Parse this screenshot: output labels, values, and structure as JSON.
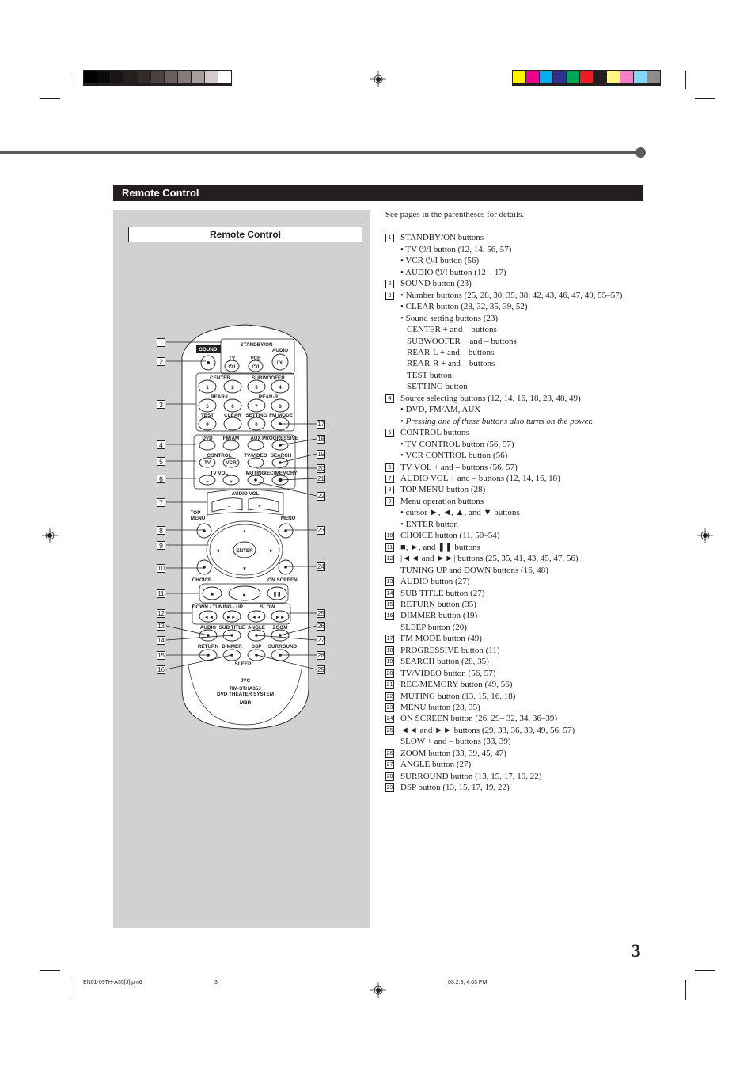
{
  "print_marks": {
    "gray_swatches": [
      "#000000",
      "#0c0a09",
      "#181514",
      "#25201e",
      "#342c2b",
      "#4a4241",
      "#6b605f",
      "#857b7a",
      "#a59d9c",
      "#d3cbca",
      "#ffffff"
    ],
    "color_swatches": [
      "#fff200",
      "#ec008c",
      "#00aeef",
      "#2e3192",
      "#00a651",
      "#ed1c24",
      "#231f20",
      "#fff67f",
      "#f680c6",
      "#80d8f7",
      "#8c8c8c"
    ]
  },
  "section_title": "Remote Control",
  "panel_title": "Remote Control",
  "remote": {
    "sound_label": "SOUND",
    "standby_label": "STANDBY/ON",
    "tv_label": "TV",
    "vcr_label": "VCR",
    "audio_label": "AUDIO",
    "power_glyph": "⏻/I",
    "center_label": "CENTER",
    "subwoofer_label": "SUBWOOFER",
    "rearl_label": "REAR-L",
    "rearr_label": "REAR-R",
    "test_label": "TEST",
    "clear_label": "CLEAR",
    "setting_label": "SETTING",
    "fmmode_label": "FM MODE",
    "digits": [
      "1",
      "2",
      "3",
      "4",
      "5",
      "6",
      "7",
      "8",
      "9",
      "0"
    ],
    "dvd_label": "DVD",
    "fmam_label": "FM/AM",
    "aux_label": "AUX",
    "progressive_label": "PROGRESSIVE",
    "control_label": "CONTROL",
    "control_tv": "TV",
    "control_vcr": "VCR",
    "tvvideo_label": "TV/VIDEO",
    "search_label": "SEARCH",
    "tvvol_label": "TV VOL",
    "muting_label": "MUTING",
    "recmemory_label": "REC/MEMORY",
    "audiovol_label": "AUDIO VOL",
    "topmenu_label_1": "TOP",
    "topmenu_label_2": "MENU",
    "menu_label": "MENU",
    "enter_label": "ENTER",
    "choice_label": "CHOICE",
    "onscreen_label": "ON SCREEN",
    "tuning_label": "DOWN - TUNING - UP",
    "slow_label": "SLOW",
    "audio2_label": "AUDIO",
    "subtitle_label": "SUB TITLE",
    "angle_label": "ANGLE",
    "zoom_label": "ZOOM",
    "return_label": "RETURN",
    "dimmer_label": "DIMMER",
    "dsp_label": "DSP",
    "surround_label": "SURROUND",
    "sleep_label": "SLEEP",
    "brand": "JVC",
    "model": "RM-STHA35J",
    "system": "DVD THEATER SYSTEM",
    "logo_mbr": "MBR",
    "callouts_left": [
      "1",
      "2",
      "3",
      "4",
      "5",
      "6",
      "7",
      "8",
      "9",
      "10",
      "11",
      "12",
      "13",
      "14",
      "15",
      "16"
    ],
    "callouts_right": [
      "17",
      "18",
      "19",
      "20",
      "21",
      "22",
      "23",
      "24",
      "25",
      "26",
      "27",
      "28",
      "29"
    ]
  },
  "description": {
    "intro": "See pages in the parentheses for details.",
    "lines": [
      {
        "num": "1",
        "text": "STANDBY/ON buttons"
      },
      {
        "num": "",
        "text": "• TV ⏻/I button (12, 14, 56, 57)"
      },
      {
        "num": "",
        "text": "• VCR ⏻/I button (56)"
      },
      {
        "num": "",
        "text": "• AUDIO  ⏻/I button (12 – 17)"
      },
      {
        "num": "2",
        "text": "SOUND button (23)"
      },
      {
        "num": "3",
        "text": "• Number buttons (25, 28, 30, 35, 38, 42, 43, 46, 47, 49, 55–57)"
      },
      {
        "num": "",
        "text": "• CLEAR button (28, 32, 35, 39, 52)"
      },
      {
        "num": "",
        "text": "• Sound setting buttons (23)"
      },
      {
        "num": "",
        "text": "CENTER + and – buttons",
        "indent": true
      },
      {
        "num": "",
        "text": "SUBWOOFER  + and – buttons",
        "indent": true
      },
      {
        "num": "",
        "text": "REAR-L  + and – buttons",
        "indent": true
      },
      {
        "num": "",
        "text": "REAR-R  + and – buttons",
        "indent": true
      },
      {
        "num": "",
        "text": "TEST button",
        "indent": true
      },
      {
        "num": "",
        "text": "SETTING button",
        "indent": true
      },
      {
        "num": "4",
        "text": "Source selecting buttons (12, 14, 16, 18, 23, 48, 49)"
      },
      {
        "num": "",
        "text": "• DVD, FM/AM, AUX"
      },
      {
        "num": "",
        "text": "• Pressing one of these buttons also turns on the power.",
        "italic": true
      },
      {
        "num": "5",
        "text": "CONTROL buttons"
      },
      {
        "num": "",
        "text": "• TV CONTROL button (56, 57)"
      },
      {
        "num": "",
        "text": "• VCR CONTROL button (56)"
      },
      {
        "num": "6",
        "text": "TV VOL + and – buttons (56, 57)"
      },
      {
        "num": "7",
        "text": "AUDIO VOL + and – buttons (12, 14, 16, 18)"
      },
      {
        "num": "8",
        "text": "TOP MENU button (28)"
      },
      {
        "num": "9",
        "text": "Menu operation buttons"
      },
      {
        "num": "",
        "text": "• cursor ►, ◄, ▲, and ▼ buttons"
      },
      {
        "num": "",
        "text": "• ENTER button"
      },
      {
        "num": "10",
        "text": "CHOICE button (11, 50–54)"
      },
      {
        "num": "11",
        "text": "■, ►, and ❚❚ buttons"
      },
      {
        "num": "12",
        "text": "|◄◄ and ►►| buttons (25, 35, 41, 43, 45, 47, 56)"
      },
      {
        "num": "",
        "text": "TUNING UP and DOWN buttons (16, 48)"
      },
      {
        "num": "13",
        "text": "AUDIO button (27)"
      },
      {
        "num": "14",
        "text": "SUB TITLE button (27)"
      },
      {
        "num": "15",
        "text": "RETURN button (35)"
      },
      {
        "num": "16",
        "text": "DIMMER button (19)"
      },
      {
        "num": "",
        "text": "SLEEP button (20)"
      },
      {
        "num": "17",
        "text": "FM MODE button (49)"
      },
      {
        "num": "18",
        "text": "PROGRESSIVE button (11)"
      },
      {
        "num": "19",
        "text": "SEARCH button  (28, 35)"
      },
      {
        "num": "20",
        "text": "TV/VIDEO button (56, 57)"
      },
      {
        "num": "21",
        "text": "REC/MEMORY button (49, 56)"
      },
      {
        "num": "22",
        "text": "MUTING button (13, 15, 16, 18)"
      },
      {
        "num": "23",
        "text": "MENU button (28, 35)"
      },
      {
        "num": "24",
        "text": "ON SCREEN button (26, 29– 32, 34, 36–39)"
      },
      {
        "num": "25",
        "text": "◄◄ and ►► buttons (29, 33, 36, 39, 49, 56, 57)"
      },
      {
        "num": "",
        "text": "SLOW + and – buttons (33, 39)"
      },
      {
        "num": "26",
        "text": "ZOOM button (33, 39, 45, 47)"
      },
      {
        "num": "27",
        "text": "ANGLE button (27)"
      },
      {
        "num": "28",
        "text": "SURROUND button (13, 15, 17, 19, 22)"
      },
      {
        "num": "29",
        "text": "DSP button (13, 15, 17, 19, 22)"
      }
    ]
  },
  "page_number": "3",
  "footer": {
    "file": "EN01-09TH-A35[J].pm6",
    "page": "3",
    "timestamp": "03.2.3, 4:03 PM"
  }
}
